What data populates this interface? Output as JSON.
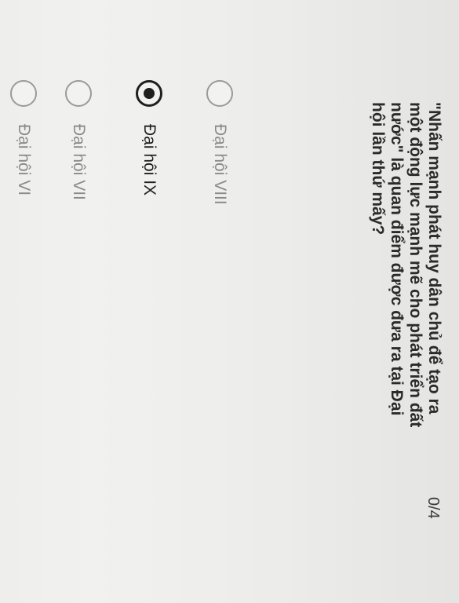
{
  "question": {
    "text": "\"Nhấn mạnh phát huy dân chủ để tạo ra một động lực mạnh mẽ cho phát triển đất nước\" là quan điểm được đưa ra tại Đại hội lần thứ mấy?",
    "points": "0/4"
  },
  "options": [
    {
      "label": "Đại hội VIII",
      "selected": false
    },
    {
      "label": "Đại hội IX",
      "selected": true
    },
    {
      "label": "Đại hội VII",
      "selected": false
    },
    {
      "label": "Đại hội VI",
      "selected": false
    }
  ]
}
